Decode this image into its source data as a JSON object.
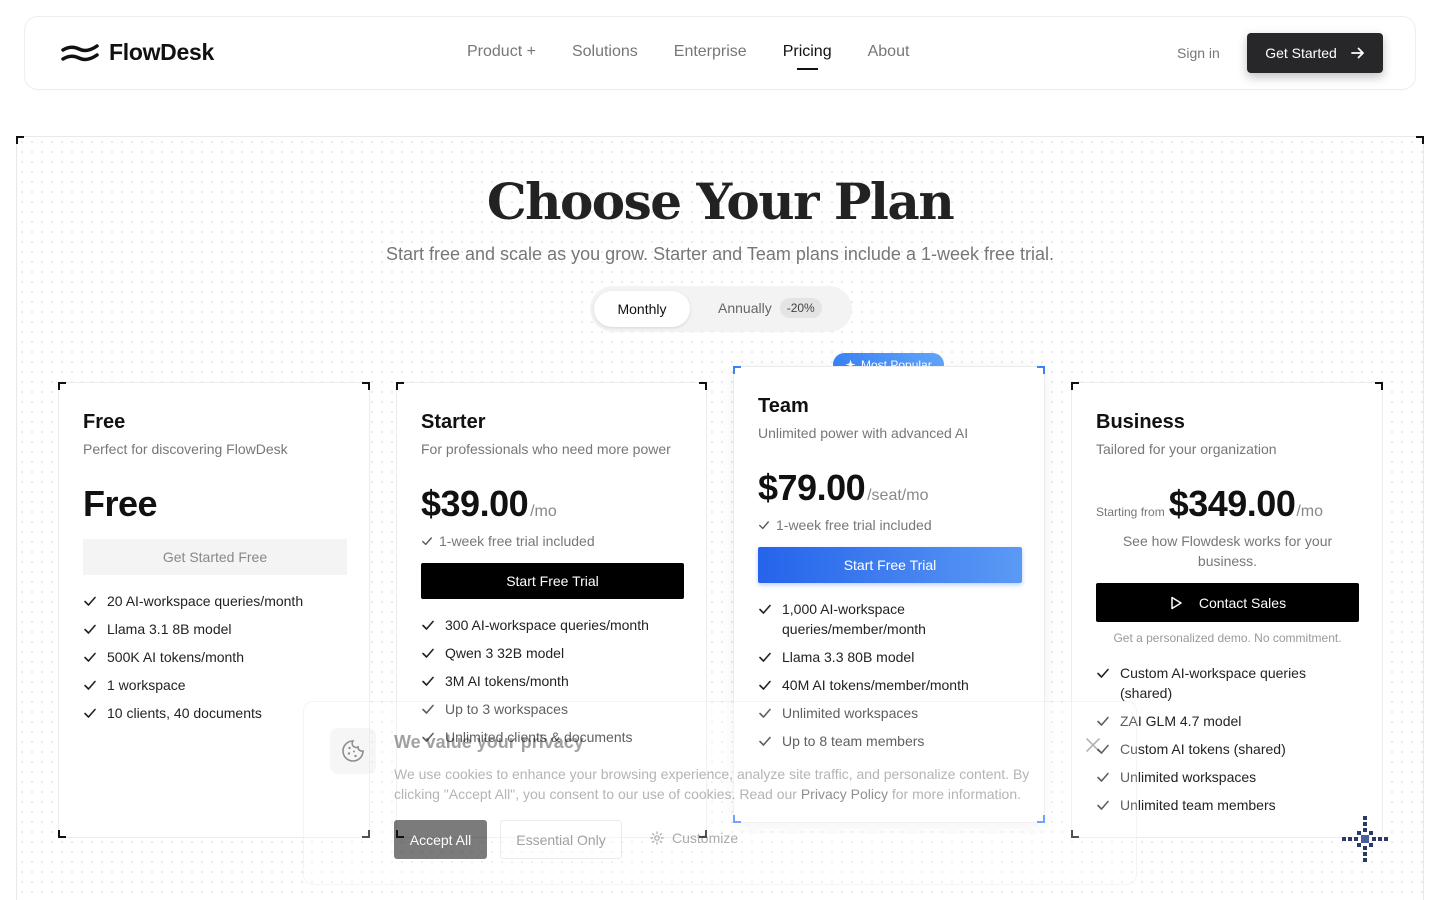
{
  "brand": {
    "name": "FlowDesk"
  },
  "nav": {
    "links": [
      "Product +",
      "Solutions",
      "Enterprise",
      "Pricing",
      "About"
    ],
    "active": "Pricing",
    "signin": "Sign in",
    "cta": "Get Started"
  },
  "hero": {
    "title": "Choose Your Plan",
    "subtitle": "Start free and scale as you grow. Starter and Team plans include a 1-week free trial."
  },
  "billing_toggle": {
    "monthly": "Monthly",
    "annually": "Annually",
    "discount": "-20%",
    "selected": "Monthly"
  },
  "plans": [
    {
      "name": "Free",
      "desc": "Perfect for discovering FlowDesk",
      "price": "Free",
      "button": "Get Started Free",
      "features": [
        "20 AI-workspace queries/month",
        "Llama 3.1 8B model",
        "500K AI tokens/month",
        "1 workspace",
        "10 clients, 40 documents"
      ]
    },
    {
      "name": "Starter",
      "desc": "For professionals who need more power",
      "price": "$39.00",
      "unit": "/mo",
      "trial": "1-week free trial included",
      "button": "Start Free Trial",
      "features": [
        "300 AI-workspace queries/month",
        "Qwen 3 32B model",
        "3M AI tokens/month",
        "Up to 3 workspaces",
        "Unlimited clients & documents"
      ]
    },
    {
      "name": "Team",
      "badge": "Most Popular",
      "desc": "Unlimited power with advanced AI",
      "price": "$79.00",
      "unit": "/seat/mo",
      "trial": "1-week free trial included",
      "button": "Start Free Trial",
      "features": [
        "1,000 AI-workspace queries/member/month",
        "Llama 3.3 80B model",
        "40M AI tokens/member/month",
        "Unlimited workspaces",
        "Up to 8 team members"
      ]
    },
    {
      "name": "Business",
      "desc": "Tailored for your organization",
      "price_prefix": "Starting from",
      "price": "$349.00",
      "unit": "/mo",
      "note": "See how Flowdesk works for your business.",
      "button": "Contact Sales",
      "subnote": "Get a personalized demo. No commitment.",
      "features": [
        "Custom AI-workspace queries (shared)",
        "ZAI GLM 4.7 model",
        "Custom AI tokens (shared)",
        "Unlimited workspaces",
        "Unlimited team members"
      ]
    }
  ],
  "cookie": {
    "title": "We value your privacy",
    "text_before": "We use cookies to enhance your browsing experience, analyze site traffic, and personalize content. By clicking \"Accept All\", you consent to our use of cookies. Read our ",
    "link": "Privacy Policy",
    "text_after": " for more information.",
    "accept": "Accept All",
    "essential": "Essential Only",
    "customize": "Customize",
    "close_icon": "close-icon"
  },
  "colors": {
    "accent": "#2563eb",
    "dark": "#27272a"
  }
}
